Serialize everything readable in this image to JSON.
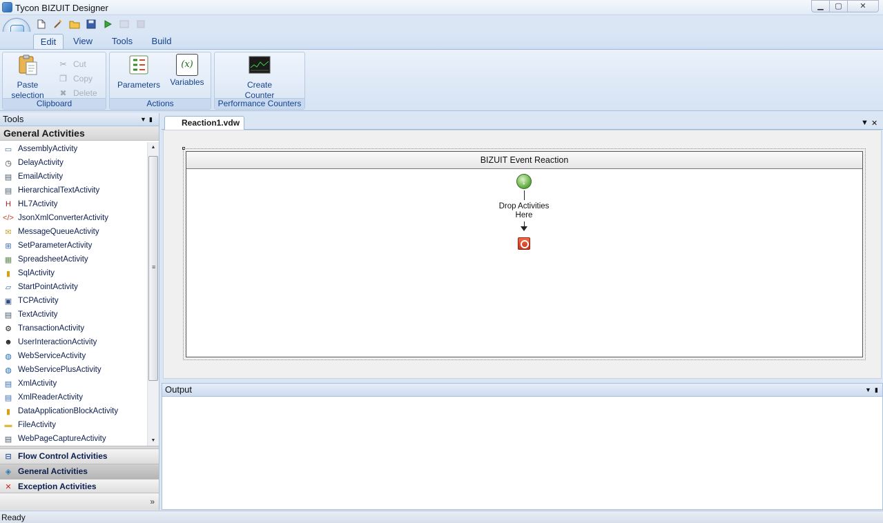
{
  "window": {
    "title": "Tycon BIZUIT Designer",
    "minimize": "▁",
    "maximize": "▢",
    "close": "✕"
  },
  "ribbon_tabs": [
    "Edit",
    "View",
    "Tools",
    "Build"
  ],
  "ribbon": {
    "clipboard": {
      "paste_line1": "Paste",
      "paste_line2": "selection",
      "cut": "Cut",
      "copy": "Copy",
      "delete": "Delete",
      "label": "Clipboard"
    },
    "actions": {
      "parameters": "Parameters",
      "variables": "Variables",
      "variables_icon": "(x)",
      "label": "Actions"
    },
    "perf": {
      "create_line1": "Create",
      "create_line2": "Counter",
      "label": "Performance Counters"
    }
  },
  "tools_panel": {
    "title": "Tools",
    "category_header": "General Activities",
    "activities": [
      {
        "label": "AssemblyActivity",
        "icon": "assembly-icon",
        "glyph": "▭",
        "color": "#4a6fa5"
      },
      {
        "label": "DelayActivity",
        "icon": "clock-icon",
        "glyph": "◷",
        "color": "#333333"
      },
      {
        "label": "EmailActivity",
        "icon": "document-icon",
        "glyph": "▤",
        "color": "#4a5a6a"
      },
      {
        "label": "HierarchicalTextActivity",
        "icon": "document-icon",
        "glyph": "▤",
        "color": "#4a5a6a"
      },
      {
        "label": "HL7Activity",
        "icon": "hl7-icon",
        "glyph": "H",
        "color": "#b32020"
      },
      {
        "label": "JsonXmlConverterActivity",
        "icon": "code-icon",
        "glyph": "</>",
        "color": "#c0392b"
      },
      {
        "label": "MessageQueueActivity",
        "icon": "envelope-icon",
        "glyph": "✉",
        "color": "#c9a227"
      },
      {
        "label": "SetParameterActivity",
        "icon": "parameter-icon",
        "glyph": "⊞",
        "color": "#3a6db0"
      },
      {
        "label": "SpreadsheetActivity",
        "icon": "spreadsheet-icon",
        "glyph": "▦",
        "color": "#6a8f5a"
      },
      {
        "label": "SqlActivity",
        "icon": "database-icon",
        "glyph": "▮",
        "color": "#d4a017"
      },
      {
        "label": "StartPointActivity",
        "icon": "startpoint-icon",
        "glyph": "▱",
        "color": "#3a6db0"
      },
      {
        "label": "TCPActivity",
        "icon": "network-icon",
        "glyph": "▣",
        "color": "#2f4f7f"
      },
      {
        "label": "TextActivity",
        "icon": "document-icon",
        "glyph": "▤",
        "color": "#4a5a6a"
      },
      {
        "label": "TransactionActivity",
        "icon": "transaction-icon",
        "glyph": "⚙",
        "color": "#222222"
      },
      {
        "label": "UserInteractionActivity",
        "icon": "user-icon",
        "glyph": "☻",
        "color": "#222222"
      },
      {
        "label": "WebServiceActivity",
        "icon": "globe-icon",
        "glyph": "◍",
        "color": "#1f6fb5"
      },
      {
        "label": "WebServicePlusActivity",
        "icon": "globe-icon",
        "glyph": "◍",
        "color": "#1f6fb5"
      },
      {
        "label": "XmlActivity",
        "icon": "xml-icon",
        "glyph": "▤",
        "color": "#3a6db0"
      },
      {
        "label": "XmlReaderActivity",
        "icon": "xml-icon",
        "glyph": "▤",
        "color": "#3a6db0"
      },
      {
        "label": "DataApplicationBlockActivity",
        "icon": "database-icon",
        "glyph": "▮",
        "color": "#d4a017"
      },
      {
        "label": "FileActivity",
        "icon": "folder-icon",
        "glyph": "▬",
        "color": "#e2b93b"
      },
      {
        "label": "WebPageCaptureActivity",
        "icon": "document-icon",
        "glyph": "▤",
        "color": "#4a5a6a"
      }
    ],
    "categories": [
      {
        "label": "Flow Control Activities",
        "icon": "flow-control-icon",
        "glyph": "⊟",
        "color": "#2a5a9a"
      },
      {
        "label": "General Activities",
        "icon": "general-activities-icon",
        "glyph": "◈",
        "color": "#2a7ab0"
      },
      {
        "label": "Exception Activities",
        "icon": "error-icon",
        "glyph": "✕",
        "color": "#cc2222"
      }
    ]
  },
  "document": {
    "tab_label": "Reaction1.vdw",
    "workflow_title": "BIZUIT Event Reaction",
    "drop_line1": "Drop Activities",
    "drop_line2": "Here"
  },
  "output_panel": {
    "title": "Output"
  },
  "status": {
    "text": "Ready"
  }
}
